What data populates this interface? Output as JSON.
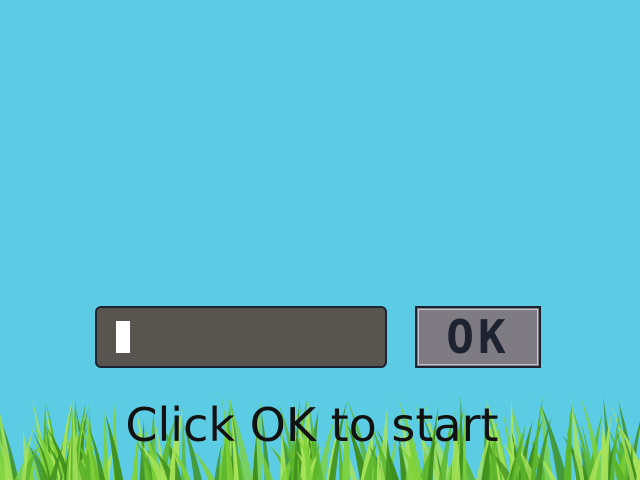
{
  "scene": {
    "background_color": "#5ccce4",
    "grass_colors": [
      "#3f8f1c",
      "#5cb52a",
      "#7fd13a",
      "#a7e35a"
    ]
  },
  "input": {
    "value": "",
    "fill_color": "#58544f",
    "caret_color": "#ffffff"
  },
  "ok_button": {
    "label": "OK",
    "fill_color": "#7f7b83"
  },
  "hint": {
    "text": "Click OK to start"
  }
}
